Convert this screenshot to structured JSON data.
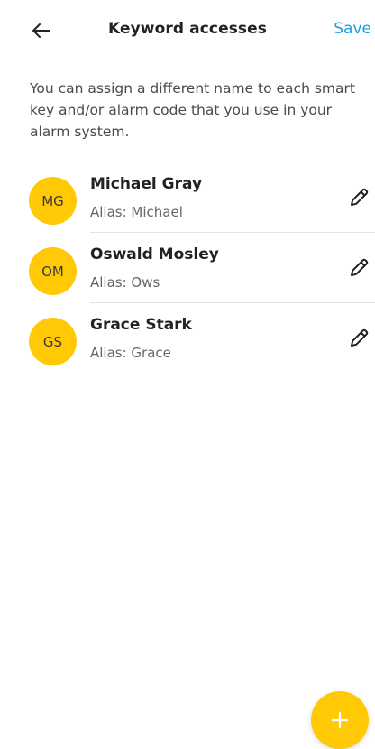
{
  "header": {
    "title": "Keyword accesses",
    "save_label": "Save",
    "back_icon": "arrow-left-icon"
  },
  "description": "You can assign a different name to each smart key and/or alarm code that you use in your alarm system.",
  "users": [
    {
      "initials": "MG",
      "name": "Michael Gray",
      "alias": "Alias: Michael"
    },
    {
      "initials": "OM",
      "name": "Oswald Mosley",
      "alias": "Alias: Ows"
    },
    {
      "initials": "GS",
      "name": "Grace Stark",
      "alias": "Alias: Grace"
    }
  ],
  "fab": {
    "icon": "plus-icon"
  },
  "colors": {
    "accent": "#ffc905",
    "link": "#1a9cde"
  }
}
